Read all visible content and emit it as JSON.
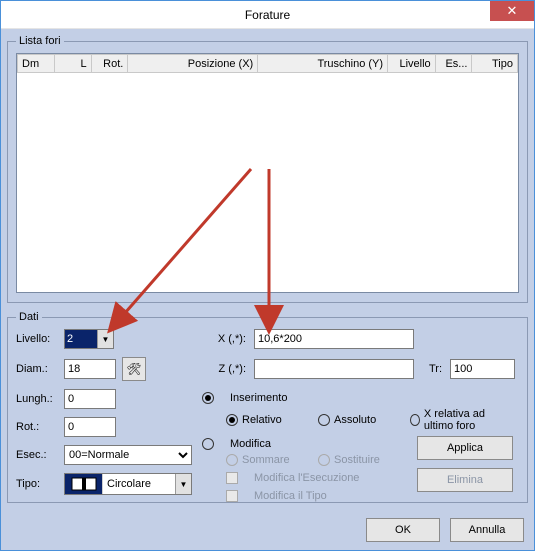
{
  "window": {
    "title": "Forature"
  },
  "lista": {
    "legend": "Lista fori",
    "columns": [
      "Dm",
      "L",
      "Rot.",
      "Posizione (X)",
      "Truschino (Y)",
      "Livello",
      "Es...",
      "Tipo"
    ]
  },
  "dati": {
    "legend": "Dati",
    "labels": {
      "livello": "Livello:",
      "diam": "Diam.:",
      "lungh": "Lungh.:",
      "rot": "Rot.:",
      "esec": "Esec.:",
      "tipo": "Tipo:",
      "x": "X (,*):",
      "z": "Z (,*):",
      "tr": "Tr:"
    },
    "values": {
      "livello": "2",
      "diam": "18",
      "lungh": "0",
      "rot": "0",
      "esec": "00=Normale",
      "tipo_label": "Circolare",
      "x": "10,6*200",
      "z": "",
      "tr": "100"
    },
    "mode": {
      "inserimento": "Inserimento",
      "relativo": "Relativo",
      "assoluto": "Assoluto",
      "xrel": "X relativa ad ultimo foro",
      "modifica": "Modifica",
      "sommare": "Sommare",
      "sostituire": "Sostituire",
      "mod_esec": "Modifica l'Esecuzione",
      "mod_tipo": "Modifica il Tipo"
    },
    "buttons": {
      "applica": "Applica",
      "elimina": "Elimina"
    }
  },
  "footer": {
    "ok": "OK",
    "annulla": "Annulla"
  },
  "colors": {
    "accent_bg": "#c3cfe6",
    "selection": "#0a246a",
    "close": "#c75050",
    "arrow": "#c0392b"
  }
}
